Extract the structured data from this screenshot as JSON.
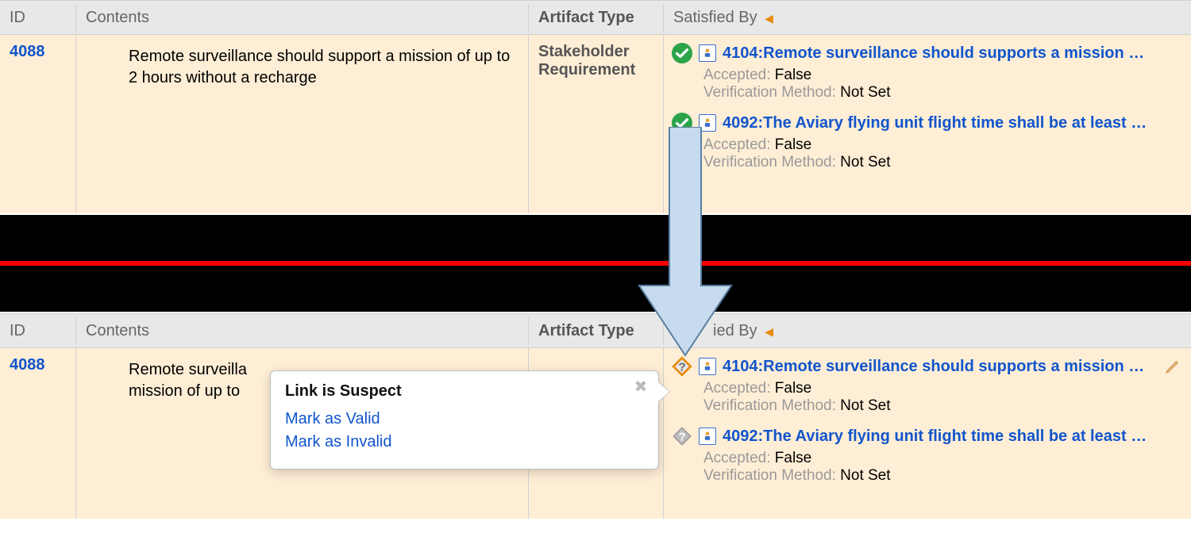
{
  "columns": {
    "id": "ID",
    "contents": "Contents",
    "type": "Artifact Type",
    "satisfied": "Satisfied By"
  },
  "popup": {
    "title": "Link is Suspect",
    "mark_valid": "Mark as Valid",
    "mark_invalid": "Mark as Invalid"
  },
  "row": {
    "id": "4088",
    "contents": "Remote surveillance should support a mission of up to 2 hours without a recharge",
    "type": "Stakeholder Requirement",
    "links": [
      {
        "status": "ok",
        "title": "4104:Remote surveillance should supports a mission …",
        "accepted_label": "Accepted:",
        "accepted_value": "False",
        "method_label": "Verification Method:",
        "method_value": "Not Set"
      },
      {
        "status": "ok",
        "title": "4092:The Aviary flying unit flight time shall be at least …",
        "accepted_label": "Accepted:",
        "accepted_value": "False",
        "method_label": "Verification Method:",
        "method_value": "Not Set"
      }
    ]
  },
  "row2": {
    "id": "4088",
    "contents_visible": "Remote surveilla\nmission of up to",
    "links": [
      {
        "status": "suspect-orange",
        "title": "4104:Remote surveillance should supports a mission …",
        "accepted_label": "Accepted:",
        "accepted_value": "False",
        "method_label": "Verification Method:",
        "method_value": "Not Set",
        "editable": true
      },
      {
        "status": "suspect-gray",
        "title": "4092:The Aviary flying unit flight time shall be at least …",
        "accepted_label": "Accepted:",
        "accepted_value": "False",
        "method_label": "Verification Method:",
        "method_value": "Not Set"
      }
    ]
  }
}
